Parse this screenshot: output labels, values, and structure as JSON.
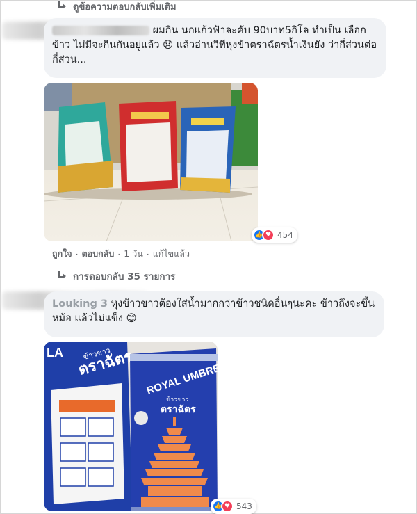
{
  "top_link": {
    "label": "ดูข้อความตอบกลับเพิ่มเติม"
  },
  "comment1": {
    "text": "ผมกิน นกแก้วฟ้าละคับ 90บาท5กิโล ทำเป็น เลือกข้าว ไม่มีจะกินกันอยู่แล้ว 😞 แล้วอ่านวิทีหุงข้าตราฉัตรน้ำเงินยัง ว่ากี่ส่วนต่อกี่ส่วน...",
    "reactions": {
      "like_icon": "like-icon",
      "love_icon": "love-icon",
      "count": "454"
    },
    "actions": {
      "like": "ถูกใจ",
      "reply": "ตอบกลับ",
      "time": "1 วัน",
      "edited": "แก้ไขแล้ว"
    },
    "replies_link": "การตอบกลับ 35 รายการ",
    "photo": {
      "bag1_label": "",
      "bag2_label": "",
      "bag3_label": ""
    }
  },
  "comment2": {
    "author_fragment": "Louking 3",
    "text": "หุงข้าวขาวต้องใส่น้ำมากกว่าข้าวชนิดอื่นๆนะคะ ข้าวถึงจะขึ้นหม้อ แล้วไม่แข็ง 😊",
    "photo": {
      "bag_left_text": "ตราฉัตร",
      "brand": "ROYAL UMBRELLA",
      "thai_small": "ข้าวขาว",
      "thai_brand": "ตราฉัตร",
      "left_thai_small": "ข้าวขาว",
      "left_corner": "LA"
    },
    "reactions": {
      "count": "543"
    }
  },
  "colors": {
    "bubble": "#f0f2f5",
    "meta": "#65676b",
    "like": "#1877f2",
    "love": "#f33e58",
    "royal_blue": "#1f3fa8"
  }
}
